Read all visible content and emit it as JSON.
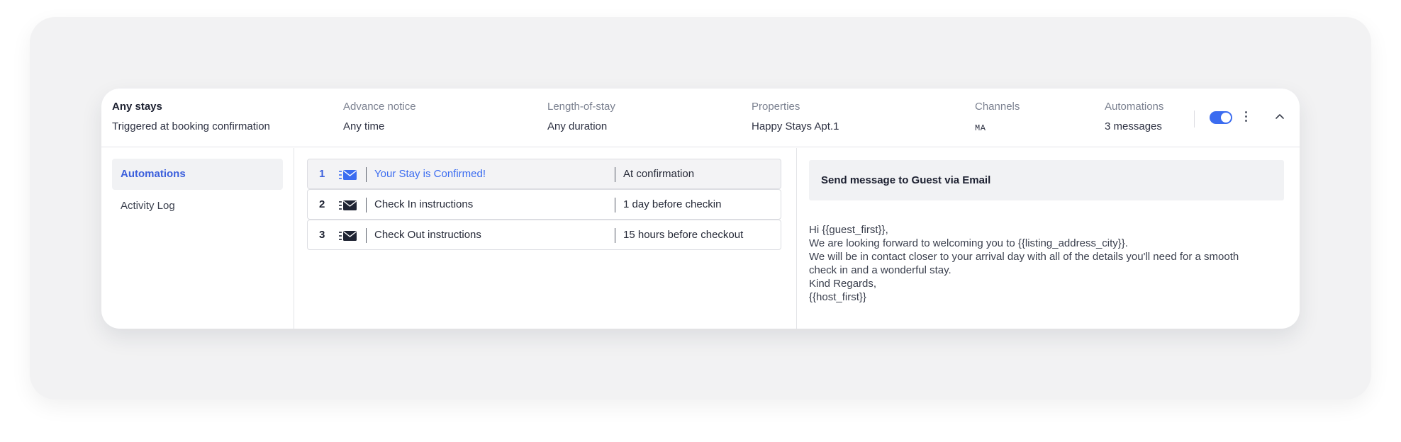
{
  "header": {
    "stays": {
      "title": "Any stays",
      "value": "Triggered at booking confirmation"
    },
    "advance_notice": {
      "label": "Advance notice",
      "value": "Any time"
    },
    "length_of_stay": {
      "label": "Length-of-stay",
      "value": "Any duration"
    },
    "properties": {
      "label": "Properties",
      "value": "Happy Stays Apt.1"
    },
    "channels": {
      "label": "Channels",
      "value": "MA"
    },
    "automations": {
      "label": "Automations",
      "value": "3 messages"
    },
    "toggle_enabled": true
  },
  "sidebar": {
    "items": [
      {
        "label": "Automations",
        "active": true
      },
      {
        "label": "Activity Log",
        "active": false
      }
    ]
  },
  "messages": [
    {
      "num": "1",
      "title": "Your Stay is Confirmed!",
      "when": "At confirmation",
      "icon": "email-icon"
    },
    {
      "num": "2",
      "title": "Check In instructions",
      "when": "1 day before checkin",
      "icon": "email-icon"
    },
    {
      "num": "3",
      "title": "Check Out instructions",
      "when": "15 hours before checkout",
      "icon": "email-icon"
    }
  ],
  "detail": {
    "heading": "Send message to Guest via Email",
    "lines": [
      "Hi {{guest_first}},",
      "We are looking forward to welcoming you to {{listing_address_city}}.",
      "We will be in contact closer to your arrival day with all of the details you'll need for a smooth",
      "check in and a wonderful stay.",
      "Kind Regards,",
      "{{host_first}}"
    ]
  },
  "colors": {
    "accent": "#3b6cf0",
    "active_text": "#3b5fdc",
    "panel_bg": "#f1f2f4"
  }
}
